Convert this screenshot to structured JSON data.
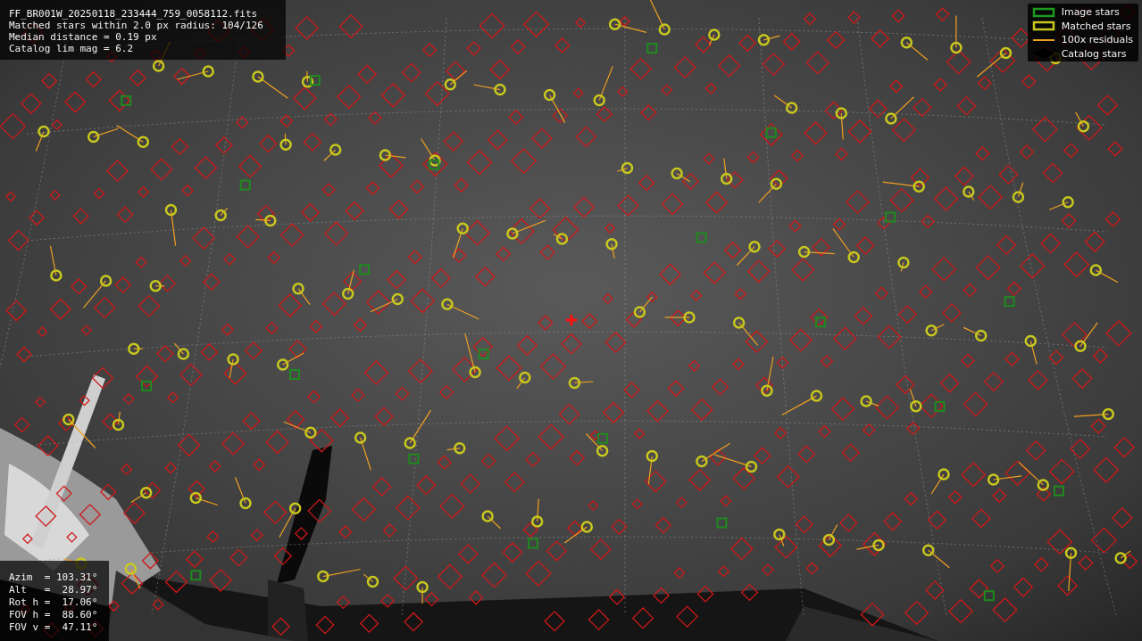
{
  "info_panel": {
    "lines": [
      "FF_BR001W_20250118_233444_759_0058112.fits",
      "Matched stars within 2.0 px radius: 104/126",
      "Median distance = 0.19 px",
      "Catalog lim mag = 6.2"
    ]
  },
  "legend": {
    "items": [
      {
        "label": "Image stars",
        "kind": "box",
        "color": "#1f9a1f"
      },
      {
        "label": "Matched stars",
        "kind": "box",
        "color": "#c8c81e"
      },
      {
        "label": "100x residuals",
        "kind": "line",
        "color": "#f0a020"
      },
      {
        "label": "Catalog stars",
        "kind": "diamond",
        "color": "#000000"
      }
    ]
  },
  "pointing_panel": {
    "lines": [
      "Azim  = 103.31°",
      "Alt   =  28.97°",
      "Rot h =  17.06°",
      "FOV h =  88.60°",
      "FOV v =  47.11°"
    ]
  }
}
